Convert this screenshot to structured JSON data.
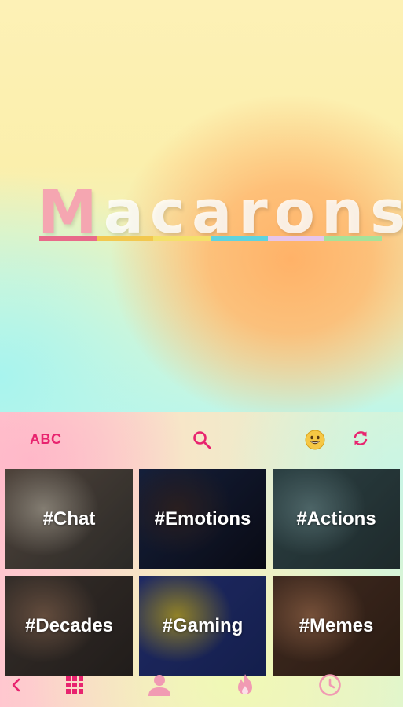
{
  "brand": {
    "title_first": "M",
    "title_rest": "acarons",
    "bar_colors": [
      "#e86a8a",
      "#f2c84f",
      "#f4e06a",
      "#5fd3df",
      "#e7c5ea",
      "#a6e29a"
    ]
  },
  "toolbar": {
    "abc_label": "ABC",
    "search_icon": "search-icon",
    "emoji_icon": "emoji-icon",
    "refresh_icon": "refresh-icon"
  },
  "categories": [
    {
      "label": "#Chat",
      "colors": [
        "#6d5d52",
        "#b6ad9e",
        "#3c3a36"
      ]
    },
    {
      "label": "#Emotions",
      "colors": [
        "#1e2c52",
        "#3a2b2c",
        "#0d0f1c"
      ]
    },
    {
      "label": "#Actions",
      "colors": [
        "#3d5a5e",
        "#6b8c8f",
        "#2a3a3c"
      ]
    },
    {
      "label": "#Decades",
      "colors": [
        "#4a403a",
        "#8a6a55",
        "#2e2825"
      ]
    },
    {
      "label": "#Gaming",
      "colors": [
        "#2c3a8a",
        "#c9b438",
        "#1c2b6a"
      ]
    },
    {
      "label": "#Memes",
      "colors": [
        "#5a3c2e",
        "#a36f4f",
        "#3a2519"
      ]
    }
  ],
  "nav": {
    "items": [
      "back-icon",
      "grid-icon",
      "person-icon",
      "fire-icon",
      "clock-icon"
    ],
    "active_color": "#e8246f",
    "inactive_color": "#f19ab3"
  },
  "colors": {
    "accent": "#e8246f"
  }
}
